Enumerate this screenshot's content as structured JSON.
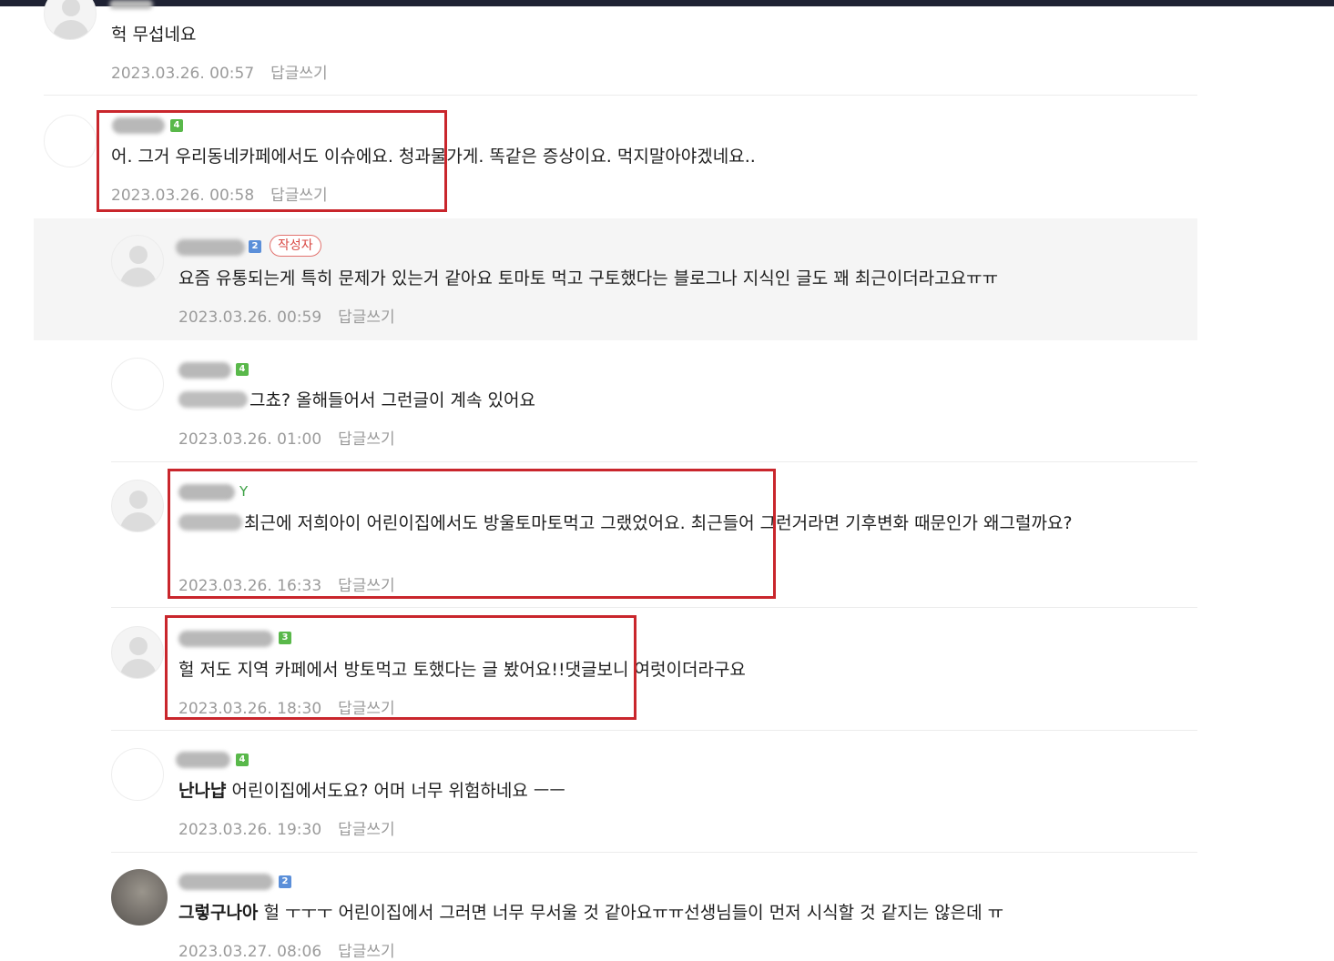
{
  "comments": [
    {
      "text": "헉 무섭네요",
      "date": "2023.03.26. 00:57",
      "reply": "답글쓰기"
    },
    {
      "text": "어. 그거 우리동네카페에서도 이슈에요. 청과물가게. 똑같은 증상이요. 먹지말아야겠네요..",
      "date": "2023.03.26. 00:58",
      "reply": "답글쓰기",
      "badge": "4"
    },
    {
      "text": "요즘 유통되는게 특히 문제가 있는거 같아요 토마토 먹고 구토했다는 블로그나 지식인 글도 꽤 최근이더라고요ㅠㅠ",
      "date": "2023.03.26. 00:59",
      "reply": "답글쓰기",
      "badge": "2",
      "author_tag": "작성자"
    },
    {
      "text": "그쵸? 올해들어서 그런글이 계속 있어요",
      "date": "2023.03.26. 01:00",
      "reply": "답글쓰기",
      "badge": "4"
    },
    {
      "text": "최근에 저희아이 어린이집에서도 방울토마토먹고 그랬었어요. 최근들어 그런거라면 기후변화 때문인가 왜그럴까요?",
      "date": "2023.03.26. 16:33",
      "reply": "답글쓰기"
    },
    {
      "text": "헐 저도 지역 카페에서 방토먹고 토했다는 글 봤어요!!댓글보니 여럿이더라구요",
      "date": "2023.03.26. 18:30",
      "reply": "답글쓰기",
      "badge": "3"
    },
    {
      "mention": "난나냡",
      "text": "어린이집에서도요? 어머 너무 위험하네요 ㅡㅡ",
      "date": "2023.03.26. 19:30",
      "reply": "답글쓰기",
      "badge": "4"
    },
    {
      "mention": "그렇구나아",
      "text": "헐 ㅜㅜㅜ 어린이집에서 그러면 너무 무서울 것 같아요ㅠㅠ선생님들이 먼저 시식할 것 같지는 않은데 ㅠ",
      "date": "2023.03.27. 08:06",
      "reply": "답글쓰기",
      "badge": "2"
    }
  ],
  "colors": {
    "highlight": "#c9262c",
    "author_tag": "#d94a45",
    "badge_green": "#59b84a",
    "badge_blue": "#5b8fd9"
  }
}
